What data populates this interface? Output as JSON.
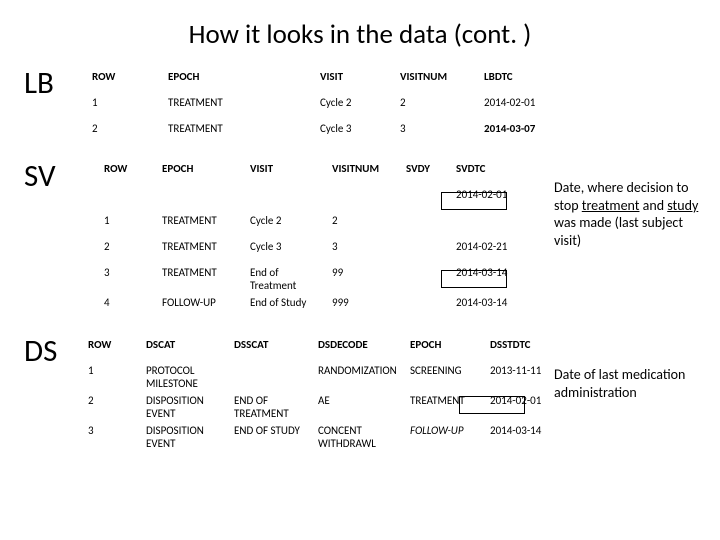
{
  "title": "How it looks in the data (cont. )",
  "sections": {
    "lb": "LB",
    "sv": "SV",
    "ds": "DS"
  },
  "lb": {
    "headers": [
      "ROW",
      "EPOCH",
      "VISIT",
      "VISITNUM",
      "LBDTC"
    ],
    "rows": [
      {
        "row": "1",
        "epoch": "TREATMENT",
        "visit": "Cycle 2",
        "visitnum": "2",
        "lbdtc": "2014-02-01"
      },
      {
        "row": "2",
        "epoch": "TREATMENT",
        "visit": "Cycle 3",
        "visitnum": "3",
        "lbdtc": "2014-03-07",
        "bold_lbdtc": true
      }
    ]
  },
  "sv": {
    "headers": [
      "ROW",
      "EPOCH",
      "VISIT",
      "VISITNUM",
      "SVDY",
      "SVDTC"
    ],
    "rows": [
      {
        "row": "",
        "epoch": "",
        "visit": "",
        "visitnum": "",
        "svdy": "",
        "svdtc": "2014-02-01"
      },
      {
        "row": "1",
        "epoch": "TREATMENT",
        "visit": "Cycle 2",
        "visitnum": "2",
        "svdy": "",
        "svdtc": ""
      },
      {
        "row": "2",
        "epoch": "TREATMENT",
        "visit": "Cycle 3",
        "visitnum": "3",
        "svdy": "",
        "svdtc": "2014-02-21"
      },
      {
        "row": "3",
        "epoch": "TREATMENT",
        "visit": "End of Treatment",
        "visitnum": "99",
        "svdy": "",
        "svdtc": "2014-03-14"
      },
      {
        "row": "4",
        "epoch": "FOLLOW-UP",
        "visit": "End of Study",
        "visitnum": "999",
        "svdy": "",
        "svdtc": "2014-03-14"
      }
    ]
  },
  "ds": {
    "headers": [
      "ROW",
      "DSCAT",
      "DSSCAT",
      "DSDECODE",
      "EPOCH",
      "DSSTDTC"
    ],
    "rows": [
      {
        "row": "1",
        "dscat": "PROTOCOL MILESTONE",
        "dsscat": "",
        "dsdecode": "RANDOMIZATION",
        "epoch": "SCREENING",
        "dsstdtc": "2013-11-11"
      },
      {
        "row": "2",
        "dscat": "DISPOSITION EVENT",
        "dsscat": "END OF TREATMENT",
        "dsdecode": "AE",
        "epoch": "TREATMENT",
        "dsstdtc": "2014-02-01"
      },
      {
        "row": "3",
        "dscat": "DISPOSITION EVENT",
        "dsscat": "END OF STUDY",
        "dsdecode": "CONCENT WITHDRAWL",
        "epoch": "FOLLOW-UP",
        "epoch_italic": true,
        "dsstdtc": "2014-03-14"
      }
    ]
  },
  "annot1": {
    "pre": "Date, where decision to stop ",
    "u1": "treatment",
    "mid": " and ",
    "u2": "study",
    "post": " was made (last subject visit)"
  },
  "annot2": "Date of last medication administration"
}
